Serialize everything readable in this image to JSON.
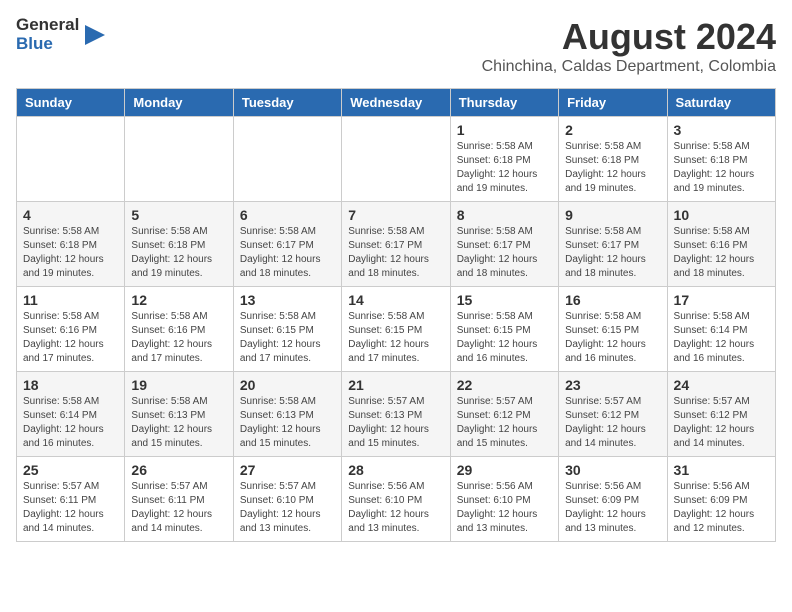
{
  "header": {
    "logo_general": "General",
    "logo_blue": "Blue",
    "title": "August 2024",
    "subtitle": "Chinchina, Caldas Department, Colombia"
  },
  "weekdays": [
    "Sunday",
    "Monday",
    "Tuesday",
    "Wednesday",
    "Thursday",
    "Friday",
    "Saturday"
  ],
  "weeks": [
    [
      {
        "day": "",
        "info": ""
      },
      {
        "day": "",
        "info": ""
      },
      {
        "day": "",
        "info": ""
      },
      {
        "day": "",
        "info": ""
      },
      {
        "day": "1",
        "info": "Sunrise: 5:58 AM\nSunset: 6:18 PM\nDaylight: 12 hours\nand 19 minutes."
      },
      {
        "day": "2",
        "info": "Sunrise: 5:58 AM\nSunset: 6:18 PM\nDaylight: 12 hours\nand 19 minutes."
      },
      {
        "day": "3",
        "info": "Sunrise: 5:58 AM\nSunset: 6:18 PM\nDaylight: 12 hours\nand 19 minutes."
      }
    ],
    [
      {
        "day": "4",
        "info": "Sunrise: 5:58 AM\nSunset: 6:18 PM\nDaylight: 12 hours\nand 19 minutes."
      },
      {
        "day": "5",
        "info": "Sunrise: 5:58 AM\nSunset: 6:18 PM\nDaylight: 12 hours\nand 19 minutes."
      },
      {
        "day": "6",
        "info": "Sunrise: 5:58 AM\nSunset: 6:17 PM\nDaylight: 12 hours\nand 18 minutes."
      },
      {
        "day": "7",
        "info": "Sunrise: 5:58 AM\nSunset: 6:17 PM\nDaylight: 12 hours\nand 18 minutes."
      },
      {
        "day": "8",
        "info": "Sunrise: 5:58 AM\nSunset: 6:17 PM\nDaylight: 12 hours\nand 18 minutes."
      },
      {
        "day": "9",
        "info": "Sunrise: 5:58 AM\nSunset: 6:17 PM\nDaylight: 12 hours\nand 18 minutes."
      },
      {
        "day": "10",
        "info": "Sunrise: 5:58 AM\nSunset: 6:16 PM\nDaylight: 12 hours\nand 18 minutes."
      }
    ],
    [
      {
        "day": "11",
        "info": "Sunrise: 5:58 AM\nSunset: 6:16 PM\nDaylight: 12 hours\nand 17 minutes."
      },
      {
        "day": "12",
        "info": "Sunrise: 5:58 AM\nSunset: 6:16 PM\nDaylight: 12 hours\nand 17 minutes."
      },
      {
        "day": "13",
        "info": "Sunrise: 5:58 AM\nSunset: 6:15 PM\nDaylight: 12 hours\nand 17 minutes."
      },
      {
        "day": "14",
        "info": "Sunrise: 5:58 AM\nSunset: 6:15 PM\nDaylight: 12 hours\nand 17 minutes."
      },
      {
        "day": "15",
        "info": "Sunrise: 5:58 AM\nSunset: 6:15 PM\nDaylight: 12 hours\nand 16 minutes."
      },
      {
        "day": "16",
        "info": "Sunrise: 5:58 AM\nSunset: 6:15 PM\nDaylight: 12 hours\nand 16 minutes."
      },
      {
        "day": "17",
        "info": "Sunrise: 5:58 AM\nSunset: 6:14 PM\nDaylight: 12 hours\nand 16 minutes."
      }
    ],
    [
      {
        "day": "18",
        "info": "Sunrise: 5:58 AM\nSunset: 6:14 PM\nDaylight: 12 hours\nand 16 minutes."
      },
      {
        "day": "19",
        "info": "Sunrise: 5:58 AM\nSunset: 6:13 PM\nDaylight: 12 hours\nand 15 minutes."
      },
      {
        "day": "20",
        "info": "Sunrise: 5:58 AM\nSunset: 6:13 PM\nDaylight: 12 hours\nand 15 minutes."
      },
      {
        "day": "21",
        "info": "Sunrise: 5:57 AM\nSunset: 6:13 PM\nDaylight: 12 hours\nand 15 minutes."
      },
      {
        "day": "22",
        "info": "Sunrise: 5:57 AM\nSunset: 6:12 PM\nDaylight: 12 hours\nand 15 minutes."
      },
      {
        "day": "23",
        "info": "Sunrise: 5:57 AM\nSunset: 6:12 PM\nDaylight: 12 hours\nand 14 minutes."
      },
      {
        "day": "24",
        "info": "Sunrise: 5:57 AM\nSunset: 6:12 PM\nDaylight: 12 hours\nand 14 minutes."
      }
    ],
    [
      {
        "day": "25",
        "info": "Sunrise: 5:57 AM\nSunset: 6:11 PM\nDaylight: 12 hours\nand 14 minutes."
      },
      {
        "day": "26",
        "info": "Sunrise: 5:57 AM\nSunset: 6:11 PM\nDaylight: 12 hours\nand 14 minutes."
      },
      {
        "day": "27",
        "info": "Sunrise: 5:57 AM\nSunset: 6:10 PM\nDaylight: 12 hours\nand 13 minutes."
      },
      {
        "day": "28",
        "info": "Sunrise: 5:56 AM\nSunset: 6:10 PM\nDaylight: 12 hours\nand 13 minutes."
      },
      {
        "day": "29",
        "info": "Sunrise: 5:56 AM\nSunset: 6:10 PM\nDaylight: 12 hours\nand 13 minutes."
      },
      {
        "day": "30",
        "info": "Sunrise: 5:56 AM\nSunset: 6:09 PM\nDaylight: 12 hours\nand 13 minutes."
      },
      {
        "day": "31",
        "info": "Sunrise: 5:56 AM\nSunset: 6:09 PM\nDaylight: 12 hours\nand 12 minutes."
      }
    ]
  ]
}
